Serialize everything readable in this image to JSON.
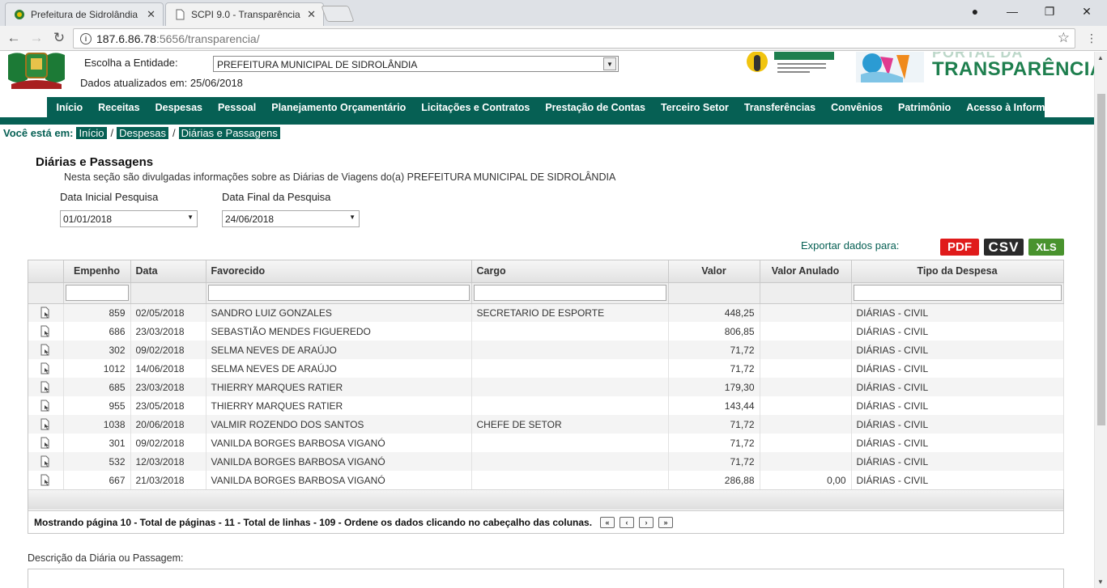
{
  "browser": {
    "tabs": [
      {
        "label": "Prefeitura de Sidrolândia",
        "active": false
      },
      {
        "label": "SCPI 9.0 - Transparência",
        "active": true
      }
    ],
    "url_host": "187.6.86.78",
    "url_rest": ":5656/transparencia/"
  },
  "header": {
    "entity_label": "Escolha a Entidade:",
    "entity_value": "PREFEITURA MUNICIPAL DE SIDROLÂNDIA",
    "updated_text": "Dados atualizados em: 25/06/2018",
    "portal_top": "PORTAL DA",
    "portal_title": "TRANSPARÊNCIA"
  },
  "menu": [
    "Início",
    "Receitas",
    "Despesas",
    "Pessoal",
    "Planejamento Orçamentário",
    "Licitações e Contratos",
    "Prestação de Contas",
    "Terceiro Setor",
    "Transferências",
    "Convênios",
    "Patrimônio",
    "Acesso à Informação"
  ],
  "breadcrumb": {
    "label": "Você está em:",
    "items": [
      "Início",
      "Despesas",
      "Diárias e Passagens"
    ]
  },
  "section": {
    "title": "Diárias e Passagens",
    "intro": "Nesta seção são divulgadas informações sobre as Diárias de Viagens do(a) PREFEITURA MUNICIPAL DE SIDROLÂNDIA",
    "start_label": "Data Inicial Pesquisa",
    "start_value": "01/01/2018",
    "end_label": "Data Final da Pesquisa",
    "end_value": "24/06/2018"
  },
  "export": {
    "label": "Exportar dados para:",
    "pdf": "PDF",
    "csv": "CSV",
    "xls": "XLS"
  },
  "grid": {
    "columns": [
      "",
      "Empenho",
      "Data",
      "Favorecido",
      "Cargo",
      "Valor",
      "Valor Anulado",
      "Tipo da Despesa"
    ],
    "rows": [
      [
        "859",
        "02/05/2018",
        "SANDRO LUIZ GONZALES",
        "SECRETARIO DE ESPORTE",
        "448,25",
        "",
        "DIÁRIAS - CIVIL"
      ],
      [
        "686",
        "23/03/2018",
        "SEBASTIÃO MENDES FIGUEREDO",
        "",
        "806,85",
        "",
        "DIÁRIAS - CIVIL"
      ],
      [
        "302",
        "09/02/2018",
        "SELMA NEVES DE ARAÚJO",
        "",
        "71,72",
        "",
        "DIÁRIAS - CIVIL"
      ],
      [
        "1012",
        "14/06/2018",
        "SELMA NEVES DE ARAÚJO",
        "",
        "71,72",
        "",
        "DIÁRIAS - CIVIL"
      ],
      [
        "685",
        "23/03/2018",
        "THIERRY MARQUES RATIER",
        "",
        "179,30",
        "",
        "DIÁRIAS - CIVIL"
      ],
      [
        "955",
        "23/05/2018",
        "THIERRY MARQUES RATIER",
        "",
        "143,44",
        "",
        "DIÁRIAS - CIVIL"
      ],
      [
        "1038",
        "20/06/2018",
        "VALMIR ROZENDO DOS SANTOS",
        "CHEFE DE SETOR",
        "71,72",
        "",
        "DIÁRIAS - CIVIL"
      ],
      [
        "301",
        "09/02/2018",
        "VANILDA BORGES BARBOSA VIGANÓ",
        "",
        "71,72",
        "",
        "DIÁRIAS - CIVIL"
      ],
      [
        "532",
        "12/03/2018",
        "VANILDA BORGES BARBOSA VIGANÓ",
        "",
        "71,72",
        "",
        "DIÁRIAS - CIVIL"
      ],
      [
        "667",
        "21/03/2018",
        "VANILDA BORGES BARBOSA VIGANÓ",
        "",
        "286,88",
        "0,00",
        "DIÁRIAS - CIVIL"
      ]
    ],
    "footer": "Mostrando página 10 - Total de páginas - 11 - Total de linhas - 109 - Ordene os dados clicando no cabeçalho das colunas."
  },
  "description_label": "Descrição da Diária ou Passagem:",
  "colors": {
    "brand": "#066054",
    "pdf": "#e01b1b",
    "csv": "#2a2a2a",
    "xls": "#49932e"
  }
}
